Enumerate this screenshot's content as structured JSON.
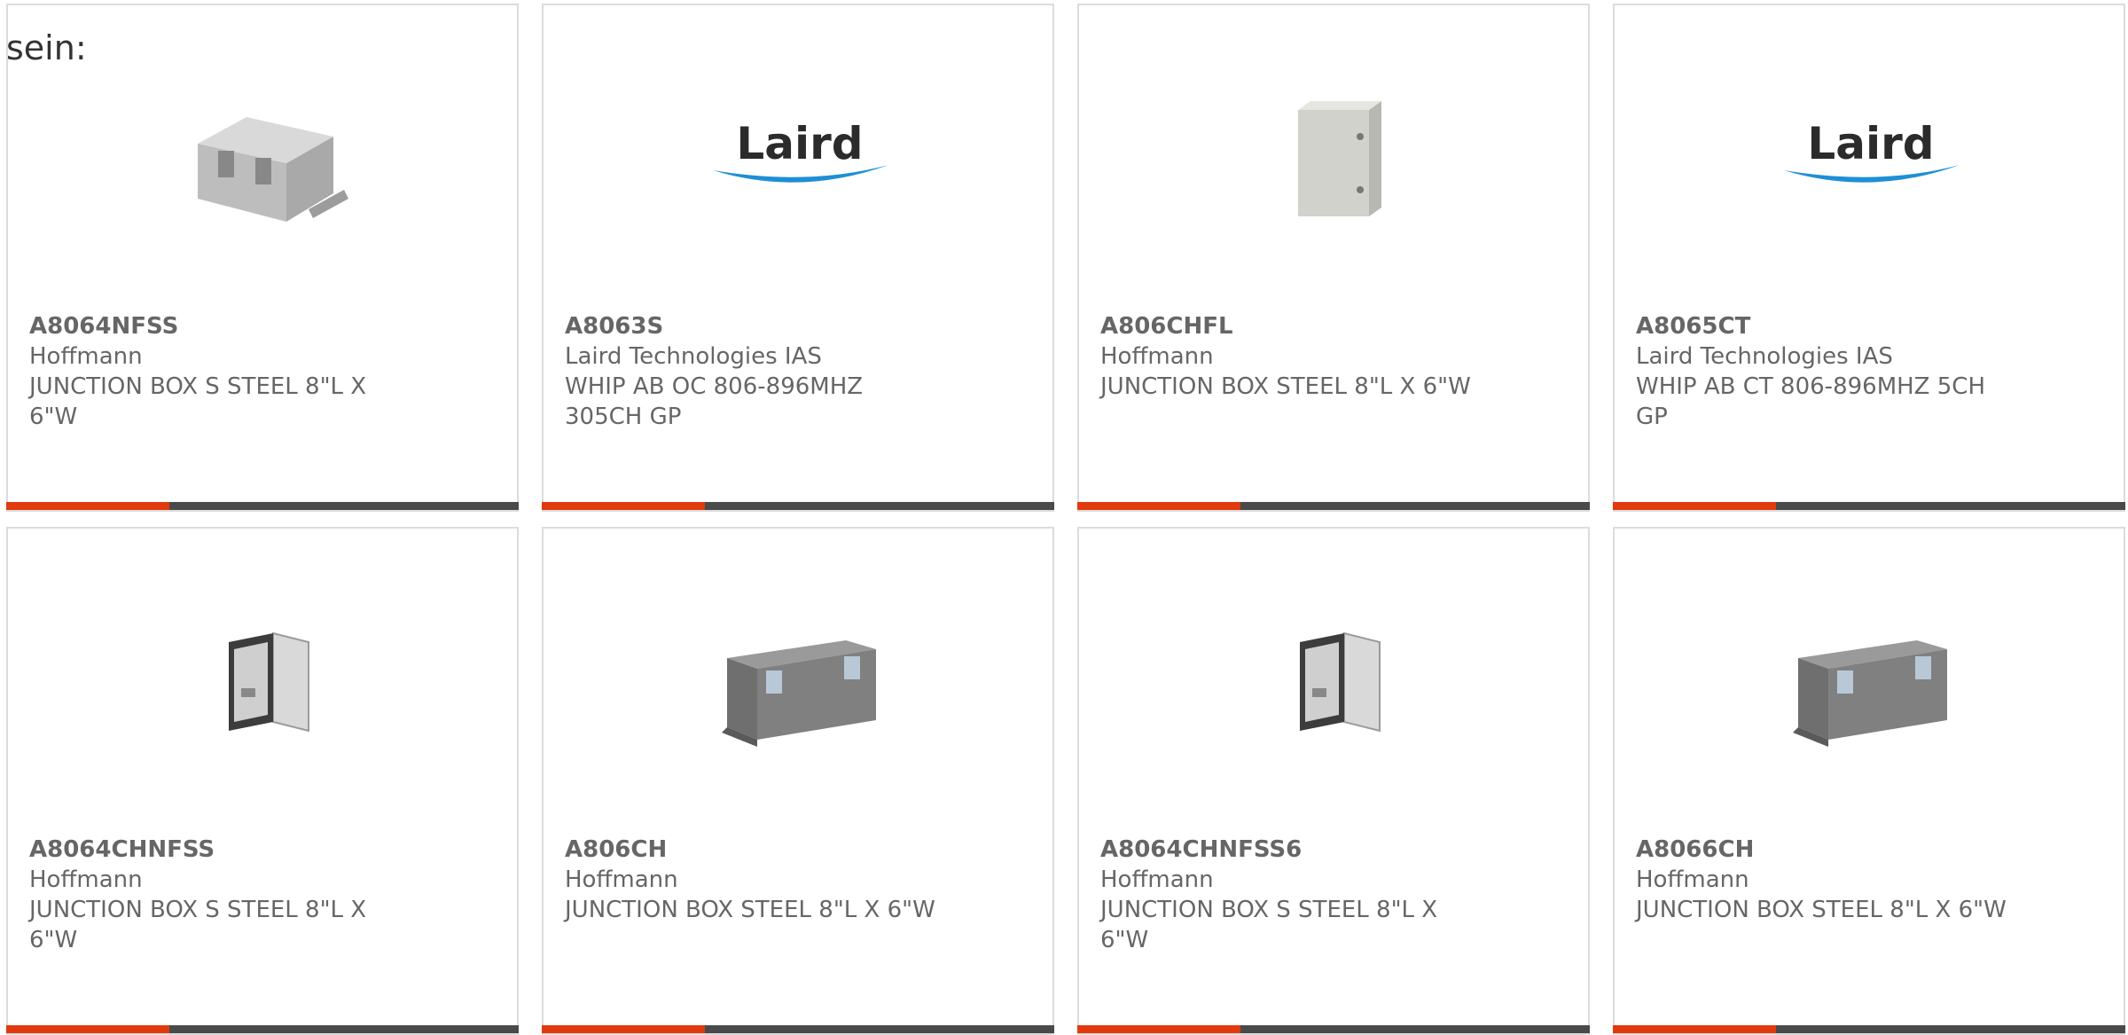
{
  "intro_text": "sein:",
  "colors": {
    "accent": "#e03a0e",
    "bar": "#4a4a4a",
    "text": "#666666",
    "laird_blue": "#1e8fd6"
  },
  "products": [
    {
      "part": "A8064NFSS",
      "manufacturer": "Hoffmann",
      "description": "JUNCTION BOX S STEEL 8\"L X 6\"W",
      "image": "stainless-box-closed-image"
    },
    {
      "part": "A8063S",
      "manufacturer": "Laird Technologies IAS",
      "description": "WHIP AB OC 806-896MHZ 305CH GP",
      "image": "laird-logo",
      "logo_text": "Laird"
    },
    {
      "part": "A806CHFL",
      "manufacturer": "Hoffmann",
      "description": "JUNCTION BOX STEEL 8\"L X 6\"W",
      "image": "gray-enclosure-image"
    },
    {
      "part": "A8065CT",
      "manufacturer": "Laird Technologies IAS",
      "description": "WHIP AB CT 806-896MHZ 5CH GP",
      "image": "laird-logo",
      "logo_text": "Laird"
    },
    {
      "part": "A8064CHNFSS",
      "manufacturer": "Hoffmann",
      "description": "JUNCTION BOX S STEEL 8\"L X 6\"W",
      "image": "open-box-image"
    },
    {
      "part": "A806CH",
      "manufacturer": "Hoffmann",
      "description": "JUNCTION BOX STEEL 8\"L X 6\"W",
      "image": "gray-box-image"
    },
    {
      "part": "A8064CHNFSS6",
      "manufacturer": "Hoffmann",
      "description": "JUNCTION BOX S STEEL 8\"L X 6\"W",
      "image": "open-box-image"
    },
    {
      "part": "A8066CH",
      "manufacturer": "Hoffmann",
      "description": "JUNCTION BOX STEEL 8\"L X 6\"W",
      "image": "gray-box-image"
    }
  ]
}
